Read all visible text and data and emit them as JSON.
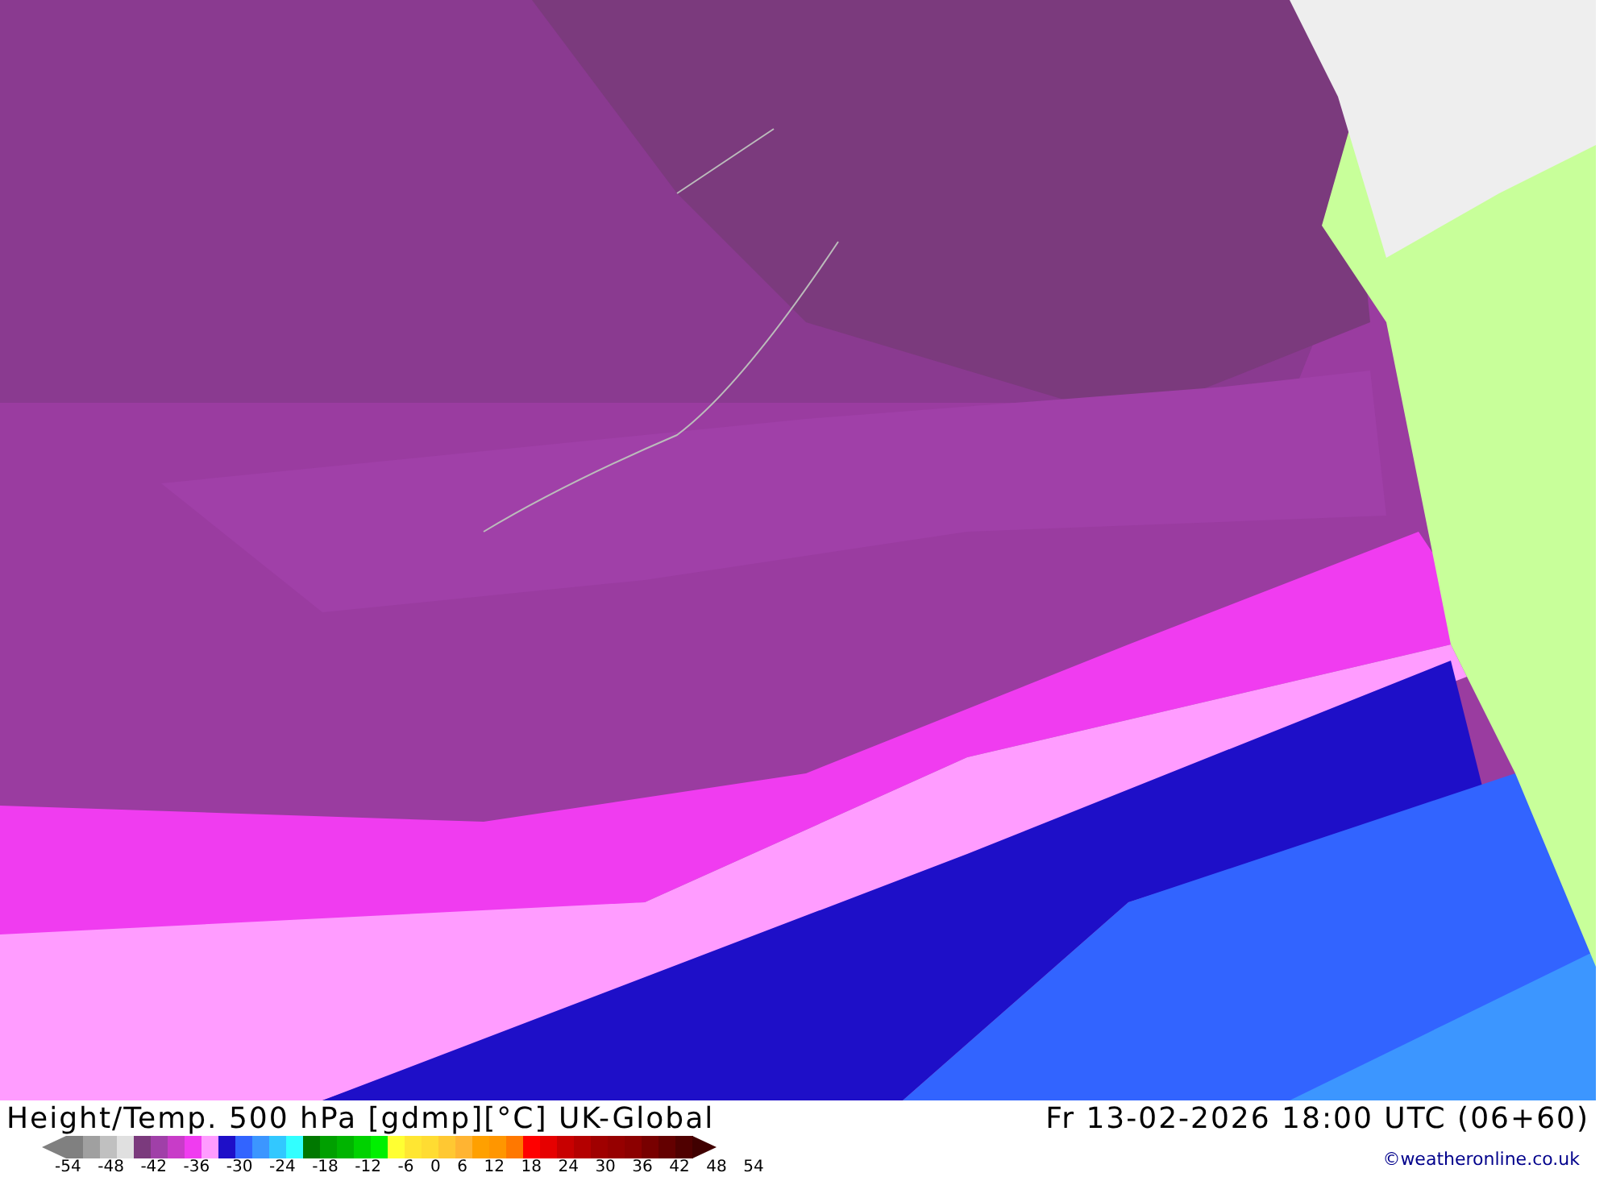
{
  "title": "Height/Temp. 500 hPa [gdmp][°C] UK-Global",
  "valid_time": "Fr 13-02-2026 18:00 UTC (06+60)",
  "legend": {
    "ticks": [
      "-54",
      "-48",
      "-42",
      "-36",
      "-30",
      "-24",
      "-18",
      "-12",
      "-6",
      "0",
      "6",
      "12",
      "18",
      "24",
      "30",
      "36",
      "42",
      "48",
      "54"
    ]
  },
  "copyright": "©weatheronline.co.uk"
}
